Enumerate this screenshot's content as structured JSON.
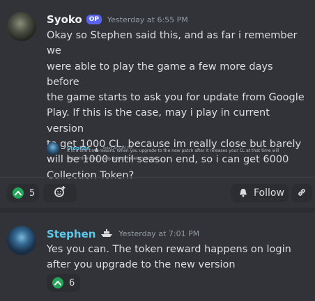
{
  "post": {
    "author": "Syoko",
    "badge": "OP",
    "timestamp": "Yesterday at 6:55 PM",
    "content": "Okay so Stephen said this, and as far i remember we\nwere able to play the game a few more days before\nthe game starts to ask you for update from Google\nPlay.  If this is the case, may i play in current version\nto get 1000 CL, because im really close but barely\nwill be 1000 until season end, so i can get 6000\nCollection Token?",
    "quoted": {
      "author": "Stephen",
      "timestamp": "Today at 5:34 PM",
      "content": "It is a one time reward.  When you upgrade to the new patch after it releases your CL at that time will\ndetermine how many bonus tokens you get"
    },
    "actions": {
      "upvote_count": "5",
      "follow_label": "Follow"
    }
  },
  "reply": {
    "author": "Stephen",
    "timestamp": "Yesterday at 7:01 PM",
    "content": "Yes you can.  The token reward happens on login\nafter you upgrade to the new version",
    "upvote_count": "6"
  },
  "colors": {
    "background": "#313338",
    "username_stephen": "#5ec8e8",
    "op_badge": "#5865f2",
    "upvote_green": "#23a55a"
  },
  "icons": [
    "upvote-icon",
    "add-reaction-icon",
    "bell-icon",
    "link-icon",
    "boat-icon"
  ]
}
